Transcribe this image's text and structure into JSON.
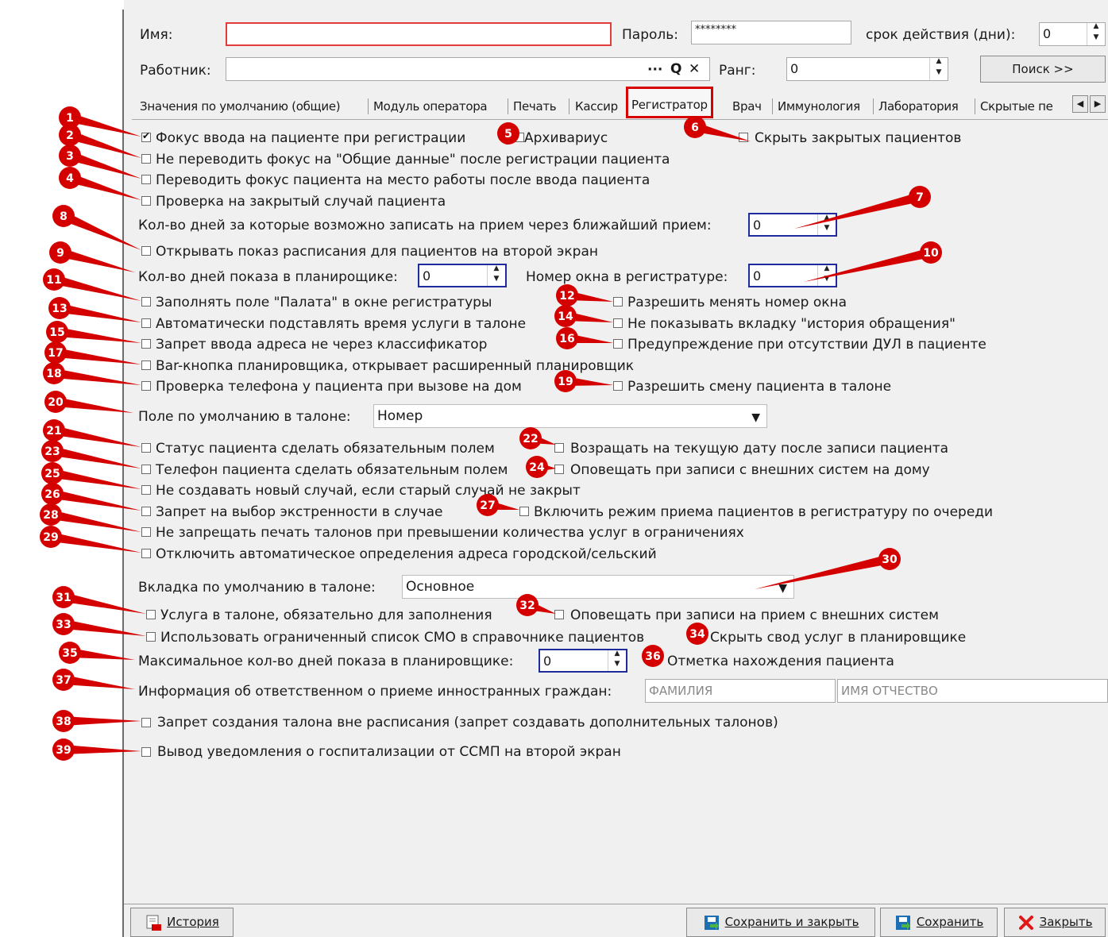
{
  "header": {
    "name_label": "Имя:",
    "name_value": "",
    "password_label": "Пароль:",
    "password_value": "********",
    "validity_label": "срок действия (дни):",
    "validity_value": "0",
    "worker_label": "Работник:",
    "worker_value": "",
    "worker_buttons": [
      "···",
      "Q",
      "✕"
    ],
    "rank_label": "Ранг:",
    "rank_value": "0",
    "search_button": "Поиск >>"
  },
  "tabs": [
    "Значения по умолчанию (общие)",
    "Модуль оператора",
    "Печать",
    "Кассир",
    "Регистратор",
    "Врач",
    "Иммунология",
    "Лаборатория",
    "Скрытые пе"
  ],
  "active_tab": "Регистратор",
  "settings": {
    "focus_patient": {
      "label": "Фокус ввода на пациенте при регистрации",
      "checked": true
    },
    "archivarius": {
      "label": "Архивариус",
      "checked": false
    },
    "hide_closed": {
      "label": "Скрыть закрытых пациентов",
      "checked": false
    },
    "no_focus_common": {
      "label": "Не переводить фокус на \"Общие данные\" после регистрации пациента",
      "checked": false
    },
    "focus_workplace": {
      "label": "Переводить фокус пациента на место работы после ввода пациента",
      "checked": false
    },
    "check_closed_case": {
      "label": "Проверка на закрытый случай пациента",
      "checked": false
    },
    "days_nearest_label": "Кол-во дней за которые возможно записать на прием через ближайший прием:",
    "days_nearest_value": "0",
    "schedule_second_screen": {
      "label": "Открывать показ расписания для пациентов на второй экран",
      "checked": false
    },
    "days_planner_label": "Кол-во дней показа в планирощике:",
    "days_planner_value": "0",
    "window_number_label": "Номер окна в регистратуре:",
    "window_number_value": "0",
    "fill_ward": {
      "label": "Заполнять поле \"Палата\" в окне регистратуры",
      "checked": false
    },
    "allow_change_window": {
      "label": "Разрешить менять номер окна",
      "checked": false
    },
    "auto_service_time": {
      "label": "Автоматически подставлять время услуги в талоне",
      "checked": false
    },
    "hide_history_tab": {
      "label": "Не показывать вкладку \"история обращения\"",
      "checked": false
    },
    "address_classifier": {
      "label": "Запрет ввода адреса не через классификатор",
      "checked": false
    },
    "warn_no_dul": {
      "label": "Предупреждение при отсутствии ДУЛ в пациенте",
      "checked": false
    },
    "bar_button": {
      "label": "Bar-кнопка планировщика, открывает расширенный планировщик",
      "checked": false
    },
    "phone_check": {
      "label": "Проверка телефона у пациента при вызове на дом",
      "checked": false
    },
    "allow_change_patient": {
      "label": "Разрешить смену пациента в талоне",
      "checked": false
    },
    "default_field_label": "Поле по умолчанию в талоне:",
    "default_field_value": "Номер",
    "status_required": {
      "label": "Статус пациента сделать обязательным полем",
      "checked": false
    },
    "return_current_date": {
      "label": "Возращать на текущую дату после записи пациента",
      "checked": false
    },
    "phone_required": {
      "label": "Телефон пациента сделать обязательным полем",
      "checked": false
    },
    "notify_home_external": {
      "label": "Оповещать при записи с внешних систем на дому",
      "checked": false
    },
    "no_new_case": {
      "label": "Не создавать новый случай, если старый случай не закрыт",
      "checked": false
    },
    "urgency_ban": {
      "label": "Запрет на выбор экстренности в случае",
      "checked": false
    },
    "queue_mode": {
      "label": "Включить режим приема пациентов в регистратуру по очереди",
      "checked": false
    },
    "print_allow": {
      "label": "Не запрещать печать талонов при превышении количества услуг в ограничениях",
      "checked": false
    },
    "auto_address_off": {
      "label": "Отключить автоматическое определения адреса городской/сельский",
      "checked": false
    },
    "default_tab_label": "Вкладка по умолчанию в талоне:",
    "default_tab_value": "Основное",
    "service_required": {
      "label": "Услуга в талоне, обязательно для заполнения",
      "checked": false
    },
    "notify_external": {
      "label": "Оповещать при записи на прием с внешних систем",
      "checked": false
    },
    "limited_smo": {
      "label": "Использовать ограниченный список СМО в справочнике пациентов",
      "checked": false
    },
    "hide_services_summary": {
      "label": "Скрыть свод услуг в планировщике",
      "checked": false
    },
    "max_days_label": "Максимальное кол-во дней показа в планировщике:",
    "max_days_value": "0",
    "patient_location": {
      "label": "Отметка нахождения пациента",
      "checked": false
    },
    "foreign_info_label": "Информация об ответственном о приеме инностранных граждан:",
    "foreign_lastname_placeholder": "ФАМИЛИЯ",
    "foreign_name_placeholder": "ИМЯ ОТЧЕСТВО",
    "extra_ticket_ban": {
      "label": "Запрет создания талона вне расписания (запрет создавать дополнительных талонов)",
      "checked": false
    },
    "ssmp_notify": {
      "label": "Вывод уведомления о госпитализации от ССМП на второй экран",
      "checked": false
    }
  },
  "markers": [
    "1",
    "2",
    "3",
    "4",
    "5",
    "6",
    "7",
    "8",
    "9",
    "10",
    "11",
    "12",
    "13",
    "14",
    "15",
    "16",
    "17",
    "18",
    "19",
    "20",
    "21",
    "22",
    "23",
    "24",
    "25",
    "26",
    "27",
    "28",
    "29",
    "30",
    "31",
    "32",
    "33",
    "34",
    "35",
    "36",
    "37",
    "38",
    "39"
  ],
  "marker_color": "#d40000",
  "footer": {
    "history": "История",
    "save_close": "Сохранить и закрыть",
    "save": "Сохранить",
    "close": "Закрыть"
  }
}
